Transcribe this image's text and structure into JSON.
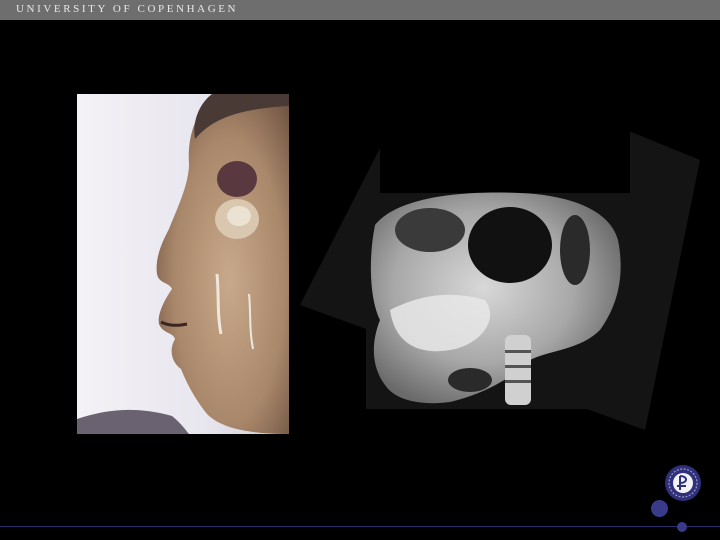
{
  "header": {
    "title": "UNIVERSITY OF COPENHAGEN"
  },
  "colors": {
    "background": "#000000",
    "header_bar": "#6e6e6e",
    "accent": "#3a3a8a"
  },
  "images": {
    "photo": "infant-face-profile-photo",
    "xray": "skull-lateral-radiograph"
  },
  "icons": {
    "seal": "university-seal-icon"
  }
}
